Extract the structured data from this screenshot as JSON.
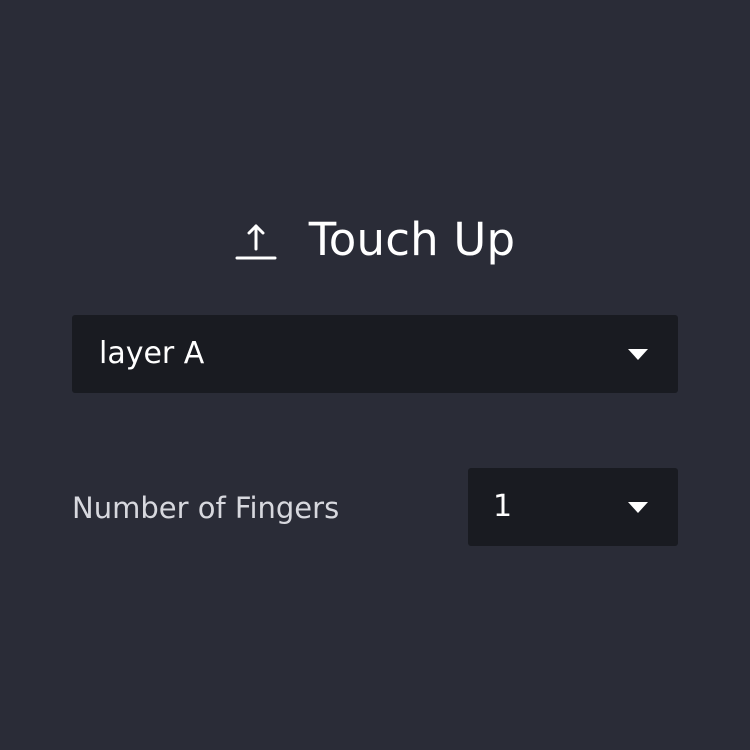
{
  "panel": {
    "title": "Touch Up",
    "title_icon": "upload-arrow-icon",
    "colors": {
      "background": "#2a2c37",
      "select_background": "#191b21",
      "primary_text": "#ffffff",
      "secondary_text": "#d7d8de"
    }
  },
  "layer_select": {
    "value": "layer A",
    "icon": "chevron-down-icon"
  },
  "fingers": {
    "label": "Number of Fingers",
    "value": "1",
    "icon": "chevron-down-icon"
  }
}
